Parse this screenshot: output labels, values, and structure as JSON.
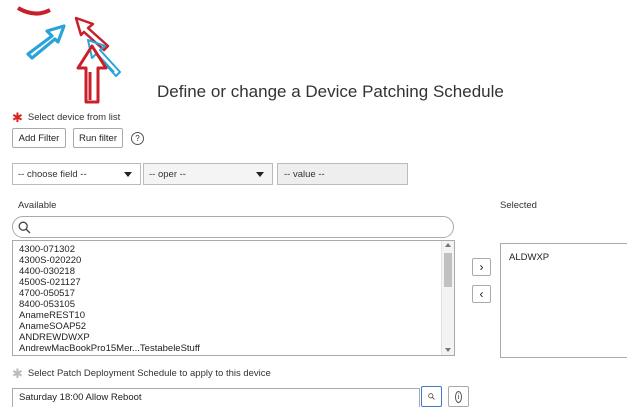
{
  "page": {
    "title": "Define or change a Device Patching Schedule"
  },
  "device_select": {
    "label": "Select device from list",
    "add_filter": "Add Filter",
    "run_filter": "Run filter",
    "help": "?"
  },
  "filter": {
    "field": "-- choose field --",
    "oper": "-- oper --",
    "value": "-- value --"
  },
  "available": {
    "label": "Available",
    "items": [
      "4300-071302",
      "4300S-020220",
      "4400-030218",
      "4500S-021127",
      "4700-050517",
      "8400-053105",
      "AnameREST10",
      "AnameSOAP52",
      "ANDREWDWXP",
      "AndrewMacBookPro15Mer...TestabeleStuff"
    ]
  },
  "selected": {
    "label": "Selected",
    "items": [
      "ALDWXP"
    ]
  },
  "move": {
    "add": "›",
    "remove": "‹"
  },
  "schedule": {
    "label": "Select Patch Deployment Schedule to apply to this device",
    "value": "Saturday 18:00 Allow Reboot",
    "info": "i"
  },
  "colors": {
    "logo_red": "#c8202a",
    "logo_blue": "#2aa3d8",
    "required_star": "#dd2222",
    "accent_blue": "#3b7bd4"
  },
  "icons": [
    "logo",
    "search-icon",
    "help-icon",
    "info-icon",
    "chevron-right-icon",
    "chevron-left-icon",
    "chevron-down-icon"
  ]
}
